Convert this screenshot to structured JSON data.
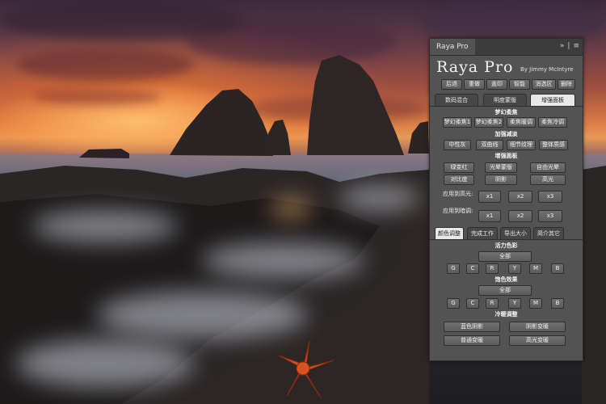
{
  "panel": {
    "tab_title": "Raya Pro",
    "menu_glyphs": [
      "»",
      "|",
      "≡"
    ],
    "brand": "Raya Pro",
    "byline": "By Jimmy McIntyre",
    "top_buttons": [
      "后退",
      "重做",
      "盖印",
      "智能",
      "消选区",
      "删除"
    ],
    "main_tabs": [
      "数码混合",
      "明度蒙版",
      "增强面板"
    ],
    "active_main_tab": 2,
    "sections": {
      "dreamy": "梦幻柔焦",
      "detail": "加强减淡",
      "enhance": "增强面板",
      "vibrance": "活力色彩",
      "saturation": "饱色效果",
      "warmcool": "冷暖调整"
    },
    "dreamy_buttons": [
      "梦幻柔焦1",
      "梦幻柔焦2",
      "柔焦暖调",
      "柔焦冷调"
    ],
    "detail_buttons": [
      "中性灰",
      "双曲线",
      "细节纹理",
      "整体质感"
    ],
    "enhance_buttons": [
      "绿变红",
      "光晕蒙版",
      "自由光晕",
      "对比度",
      "阴影",
      "高光"
    ],
    "apply_highlight_label": "应用到高光:",
    "apply_shadow_label": "应用到暗调:",
    "multipliers": [
      "x1",
      "x2",
      "x3"
    ],
    "sub_tabs": [
      "颜色调整",
      "完成工作",
      "导出大小",
      "简介其它"
    ],
    "active_sub_tab": 0,
    "all_label": "全部",
    "color_buttons": [
      "G",
      "C",
      "R",
      "Y",
      "M",
      "B"
    ],
    "warmcool_buttons": [
      "蓝色阴影",
      "阴影变暖",
      "普通变暖",
      "高光变暖"
    ]
  }
}
